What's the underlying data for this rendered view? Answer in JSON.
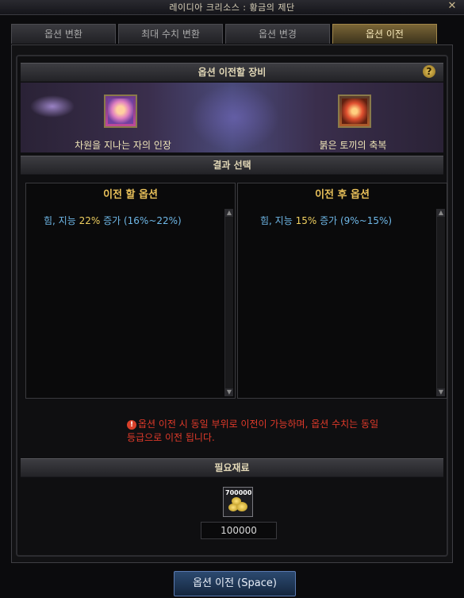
{
  "window": {
    "title": "레이디아 크리소스 : 황금의 제단"
  },
  "tabs": [
    {
      "label": "옵션 변환",
      "active": false
    },
    {
      "label": "최대 수치 변환",
      "active": false
    },
    {
      "label": "옵션 변경",
      "active": false
    },
    {
      "label": "옵션 이전",
      "active": true
    }
  ],
  "equip_section": {
    "title": "옵션 이전할 장비",
    "help_icon": "?",
    "left_item": {
      "icon": "seal-icon",
      "label": "차원을 지나는 자의 인장"
    },
    "right_item": {
      "icon": "rabbit-blessing-icon",
      "label": "붉은 토끼의 축복"
    }
  },
  "result_section": {
    "title": "결과 선택",
    "before": {
      "header": "이전 할 옵션",
      "option_prefix": "힘, 지능 ",
      "option_value": "22%",
      "option_suffix": " 증가 (16%~22%)"
    },
    "after": {
      "header": "이전 후 옵션",
      "option_prefix": "힘, 지능 ",
      "option_value": "15%",
      "option_suffix": " 증가 (9%~15%)"
    }
  },
  "warning": {
    "icon": "!",
    "text": "옵션 이전 시 동일 부위로 이전이 가능하며, 옵션 수치는 동일 등급으로 이전 됩니다."
  },
  "materials": {
    "title": "필요재료",
    "item_count_label": "700000",
    "icon": "gold-coin-icon",
    "required_amount": "100000"
  },
  "action_button": {
    "label": "옵션 이전 (Space)"
  },
  "colors": {
    "accent_gold": "#e9c15a",
    "option_blue": "#6fb8e8",
    "warning_red": "#e03a2a",
    "button_blue": "#2c4a70"
  }
}
